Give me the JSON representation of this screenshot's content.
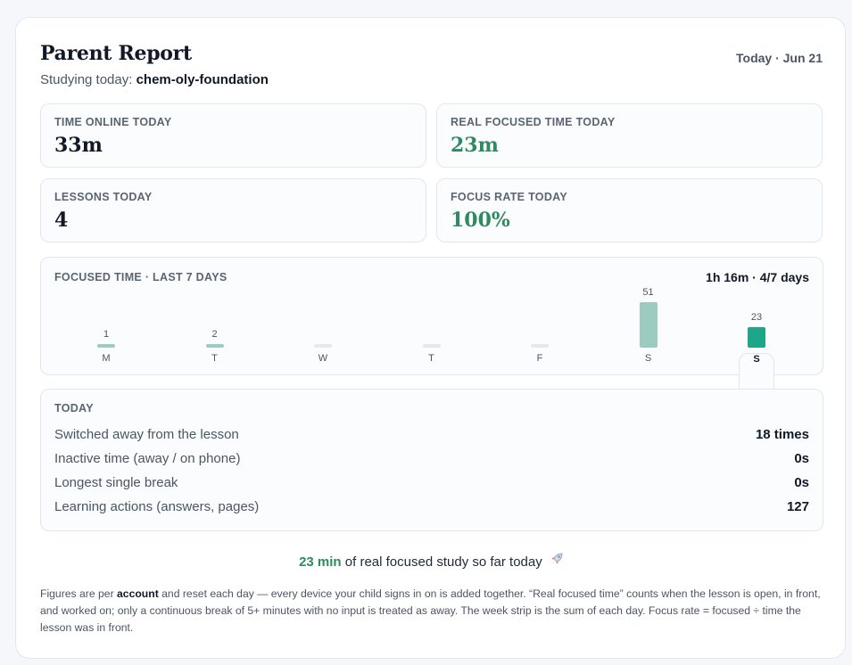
{
  "header": {
    "title": "Parent Report",
    "studying_prefix": "Studying today: ",
    "course": "chem-oly-foundation",
    "date": "Today · Jun 21"
  },
  "stats": [
    {
      "label": "TIME ONLINE TODAY",
      "value": "33m"
    },
    {
      "label": "REAL FOCUSED TIME TODAY",
      "value": "23m"
    },
    {
      "label": "LESSONS TODAY",
      "value": "4"
    },
    {
      "label": "FOCUS RATE TODAY",
      "value": "100%"
    }
  ],
  "week": {
    "label": "FOCUSED TIME · LAST 7 DAYS",
    "summary": "1h 16m · 4/7 days"
  },
  "chart_data": {
    "type": "bar",
    "categories": [
      "M",
      "T",
      "W",
      "T",
      "F",
      "S",
      "S"
    ],
    "values": [
      1,
      2,
      0,
      0,
      0,
      51,
      23
    ],
    "value_labels": [
      "1",
      "2",
      "",
      "",
      "",
      "51",
      "23"
    ],
    "today_index": 6,
    "colors": {
      "past": "#9ccbbf",
      "empty": "#e6e8ec",
      "today": "#1fa58a"
    }
  },
  "today": {
    "label": "TODAY",
    "rows": [
      {
        "label": "Switched away from the lesson",
        "value": "18 times"
      },
      {
        "label": "Inactive time (away / on phone)",
        "value": "0s"
      },
      {
        "label": "Longest single break",
        "value": "0s"
      },
      {
        "label": "Learning actions (answers, pages)",
        "value": "127"
      }
    ]
  },
  "cta": {
    "highlight": "23 min",
    "text": " of real focused study so far today",
    "icon": "rocket-icon"
  },
  "footnote": {
    "part1": "Figures are per ",
    "bold": "account",
    "part2": " and reset each day — every device your child signs in on is added together. “Real focused time” counts when the lesson is open, in front, and worked on; only a continuous break of 5+ minutes with no input is treated as away. The week strip is the sum of each day. Focus rate = focused ÷ time the lesson was in front."
  },
  "colors": {
    "accent_green": "#2f8a62",
    "border": "#e3e6ec"
  }
}
